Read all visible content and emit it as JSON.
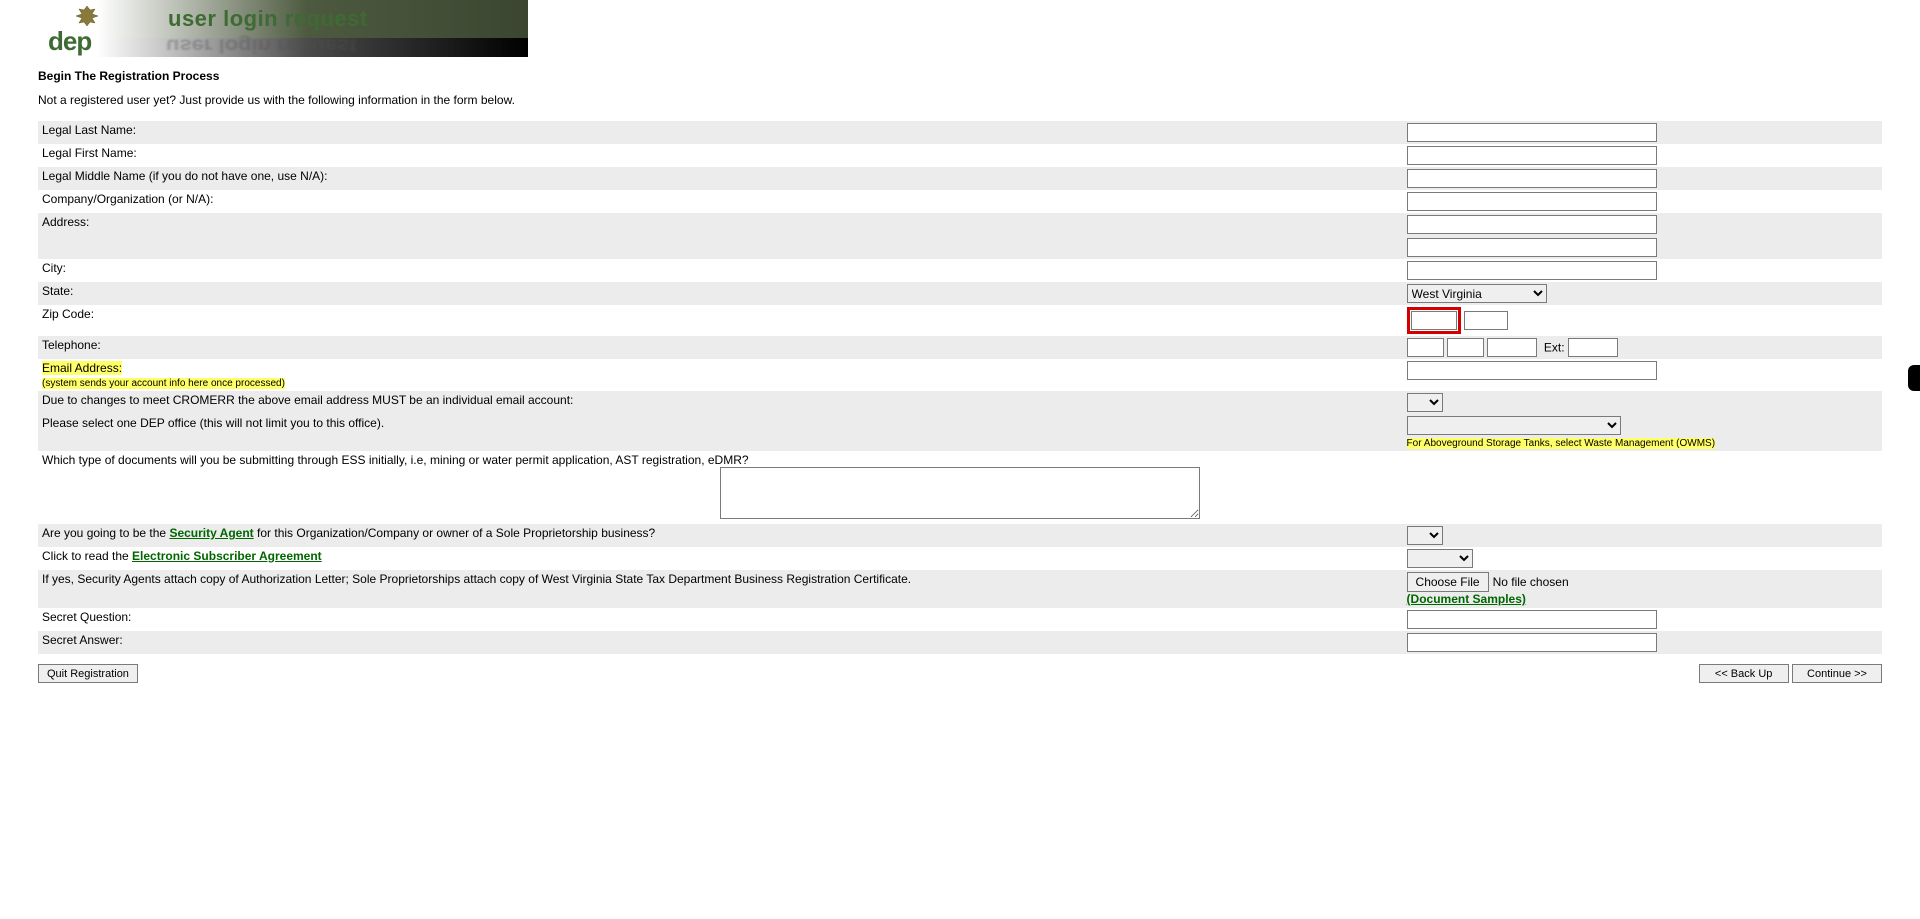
{
  "banner": {
    "title": "user login request",
    "logo_text": "dep"
  },
  "headings": {
    "section_title": "Begin The Registration Process",
    "intro": "Not a registered user yet? Just provide us with the following information in the form below."
  },
  "labels": {
    "last_name": "Legal Last Name:",
    "first_name": "Legal First Name:",
    "middle_name": "Legal Middle Name (if you do not have one, use N/A):",
    "company": "Company/Organization (or N/A):",
    "address": "Address:",
    "city": "City:",
    "state": "State:",
    "zip": "Zip Code:",
    "telephone": "Telephone:",
    "ext": "Ext:",
    "email": "Email Address:",
    "email_note": "(system sends your account info here once processed)",
    "cromerr": "Due to changes to meet CROMERR the above email address MUST be an individual email account:",
    "dep_office": "Please select one DEP office (this will not limit you to this office).",
    "dep_office_note": "For Aboveground Storage Tanks, select Waste Management (OWMS)",
    "doc_types": "Which type of documents will you be submitting through ESS initially, i.e, mining or water permit application, AST registration, eDMR?",
    "security_agent_pre": "Are you going to be the ",
    "security_agent_link": "Security Agent",
    "security_agent_post": " for this Organization/Company or owner of a Sole Proprietorship business?",
    "esa_pre": "Click to read the ",
    "esa_link": "Electronic Subscriber Agreement",
    "attach": "If yes, Security Agents attach copy of Authorization Letter; Sole Proprietorships attach copy of West Virginia State Tax Department Business Registration Certificate.",
    "doc_samples": "(Document Samples)",
    "secret_q": "Secret Question:",
    "secret_a": "Secret Answer:"
  },
  "values": {
    "last_name": "",
    "first_name": "",
    "middle_name": "",
    "company": "",
    "address1": "",
    "address2": "",
    "city": "",
    "state_selected": "West Virginia",
    "zip5": "",
    "zip4": "",
    "tel1": "",
    "tel2": "",
    "tel3": "",
    "ext": "",
    "email": "",
    "cromerr_selected": "",
    "dep_office_selected": "",
    "doc_types": "",
    "security_agent_selected": "",
    "esa_selected": "",
    "file_selected": "No file chosen",
    "secret_q": "",
    "secret_a": ""
  },
  "buttons": {
    "choose_file": "Choose File",
    "quit": "Quit Registration",
    "back": "<< Back Up",
    "continue": "Continue >>"
  }
}
